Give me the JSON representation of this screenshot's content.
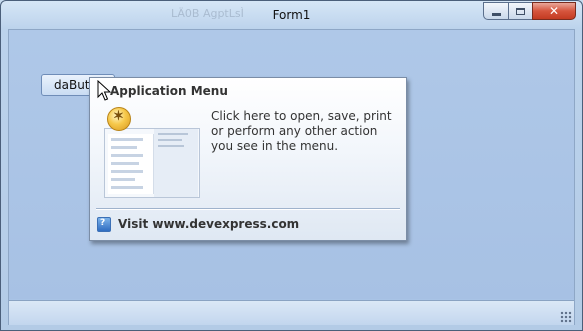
{
  "window": {
    "title": "Form1",
    "background_title_ghost": "LÄ0B  AgptLsÌ"
  },
  "button": {
    "label": "daButton"
  },
  "tooltip": {
    "title": "Application Menu",
    "body": "Click here to open, save, print or perform any  other action you see in the menu.",
    "footer": "Visit www.devexpress.com"
  },
  "icons": {
    "minimize": "minimize-icon",
    "maximize": "maximize-icon",
    "close": "close-icon",
    "help": "help-icon",
    "cursor": "mouse-pointer-icon",
    "size_grip": "resize-grip-icon"
  },
  "colors": {
    "form_background": "#a9c4e6",
    "close_button": "#d6553d",
    "tooltip_text": "#333333"
  }
}
